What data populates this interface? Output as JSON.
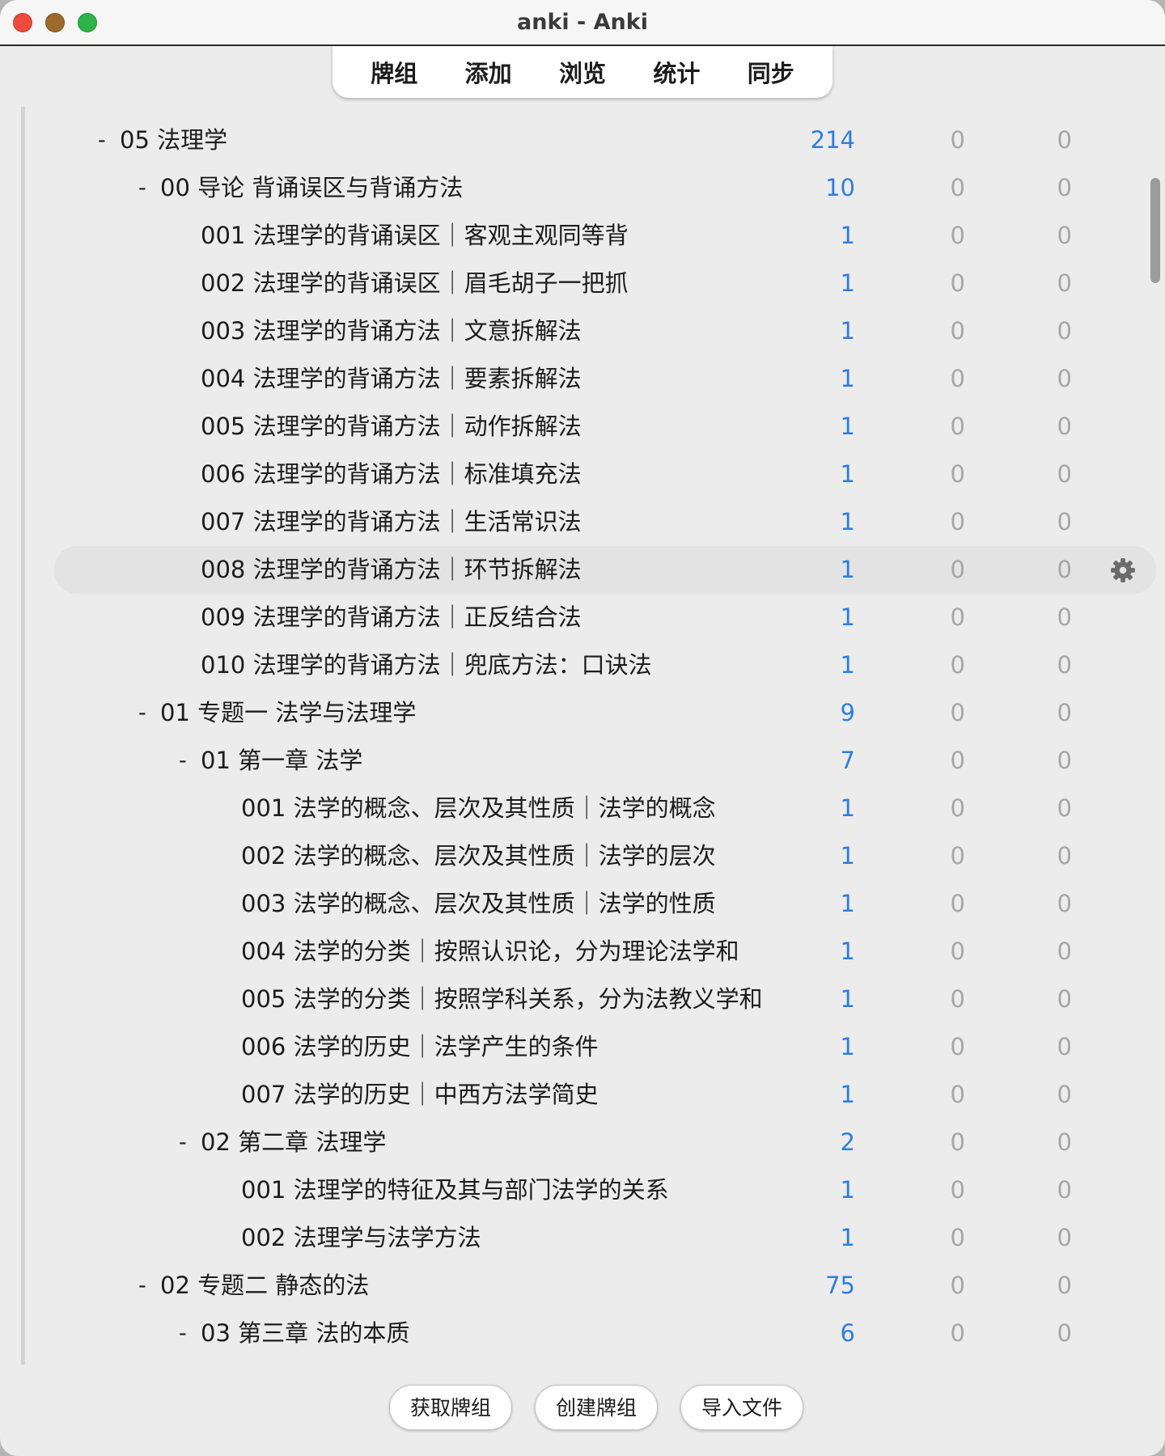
{
  "window": {
    "title": "anki - Anki"
  },
  "toolbar": {
    "items": [
      "牌组",
      "添加",
      "浏览",
      "统计",
      "同步"
    ]
  },
  "colors": {
    "new_count": "#2d7ee0",
    "zero_count": "#a6a6a6",
    "selected_row": "#e3e3e3"
  },
  "decks": [
    {
      "name": "05 法理学",
      "level": 0,
      "expanded": true,
      "collapse": "-",
      "new": "214",
      "learn": "0",
      "due": "0"
    },
    {
      "name": "00 导论 背诵误区与背诵方法",
      "level": 1,
      "expanded": true,
      "collapse": "-",
      "new": "10",
      "learn": "0",
      "due": "0"
    },
    {
      "name": "001 法理学的背诵误区｜客观主观同等背",
      "level": 2,
      "new": "1",
      "learn": "0",
      "due": "0"
    },
    {
      "name": "002 法理学的背诵误区｜眉毛胡子一把抓",
      "level": 2,
      "new": "1",
      "learn": "0",
      "due": "0"
    },
    {
      "name": "003 法理学的背诵方法｜文意拆解法",
      "level": 2,
      "new": "1",
      "learn": "0",
      "due": "0"
    },
    {
      "name": "004 法理学的背诵方法｜要素拆解法",
      "level": 2,
      "new": "1",
      "learn": "0",
      "due": "0"
    },
    {
      "name": "005 法理学的背诵方法｜动作拆解法",
      "level": 2,
      "new": "1",
      "learn": "0",
      "due": "0"
    },
    {
      "name": "006 法理学的背诵方法｜标准填充法",
      "level": 2,
      "new": "1",
      "learn": "0",
      "due": "0"
    },
    {
      "name": "007 法理学的背诵方法｜生活常识法",
      "level": 2,
      "new": "1",
      "learn": "0",
      "due": "0"
    },
    {
      "name": "008 法理学的背诵方法｜环节拆解法",
      "level": 2,
      "new": "1",
      "learn": "0",
      "due": "0",
      "selected": true,
      "options_icon": "gear-icon"
    },
    {
      "name": "009 法理学的背诵方法｜正反结合法",
      "level": 2,
      "new": "1",
      "learn": "0",
      "due": "0"
    },
    {
      "name": "010 法理学的背诵方法｜兜底方法：口诀法",
      "level": 2,
      "new": "1",
      "learn": "0",
      "due": "0"
    },
    {
      "name": "01 专题一 法学与法理学",
      "level": 1,
      "expanded": true,
      "collapse": "-",
      "new": "9",
      "learn": "0",
      "due": "0"
    },
    {
      "name": "01 第一章 法学",
      "level": 2,
      "expanded": true,
      "collapse": "-",
      "new": "7",
      "learn": "0",
      "due": "0"
    },
    {
      "name": "001 法学的概念、层次及其性质｜法学的概念",
      "level": 3,
      "new": "1",
      "learn": "0",
      "due": "0"
    },
    {
      "name": "002 法学的概念、层次及其性质｜法学的层次",
      "level": 3,
      "new": "1",
      "learn": "0",
      "due": "0"
    },
    {
      "name": "003 法学的概念、层次及其性质｜法学的性质",
      "level": 3,
      "new": "1",
      "learn": "0",
      "due": "0"
    },
    {
      "name": "004 法学的分类｜按照认识论，分为理论法学和",
      "level": 3,
      "new": "1",
      "learn": "0",
      "due": "0",
      "truncated": true
    },
    {
      "name": "005 法学的分类｜按照学科关系，分为法教义学和",
      "level": 3,
      "new": "1",
      "learn": "0",
      "due": "0",
      "truncated": true
    },
    {
      "name": "006 法学的历史｜法学产生的条件",
      "level": 3,
      "new": "1",
      "learn": "0",
      "due": "0"
    },
    {
      "name": "007 法学的历史｜中西方法学简史",
      "level": 3,
      "new": "1",
      "learn": "0",
      "due": "0"
    },
    {
      "name": "02 第二章 法理学",
      "level": 2,
      "expanded": true,
      "collapse": "-",
      "new": "2",
      "learn": "0",
      "due": "0"
    },
    {
      "name": "001 法理学的特征及其与部门法学的关系",
      "level": 3,
      "new": "1",
      "learn": "0",
      "due": "0"
    },
    {
      "name": "002 法理学与法学方法",
      "level": 3,
      "new": "1",
      "learn": "0",
      "due": "0"
    },
    {
      "name": "02 专题二 静态的法",
      "level": 1,
      "expanded": true,
      "collapse": "-",
      "new": "75",
      "learn": "0",
      "due": "0"
    },
    {
      "name": "03 第三章 法的本质",
      "level": 2,
      "expanded": true,
      "collapse": "-",
      "new": "6",
      "learn": "0",
      "due": "0"
    }
  ],
  "bottom_buttons": [
    "获取牌组",
    "创建牌组",
    "导入文件"
  ]
}
